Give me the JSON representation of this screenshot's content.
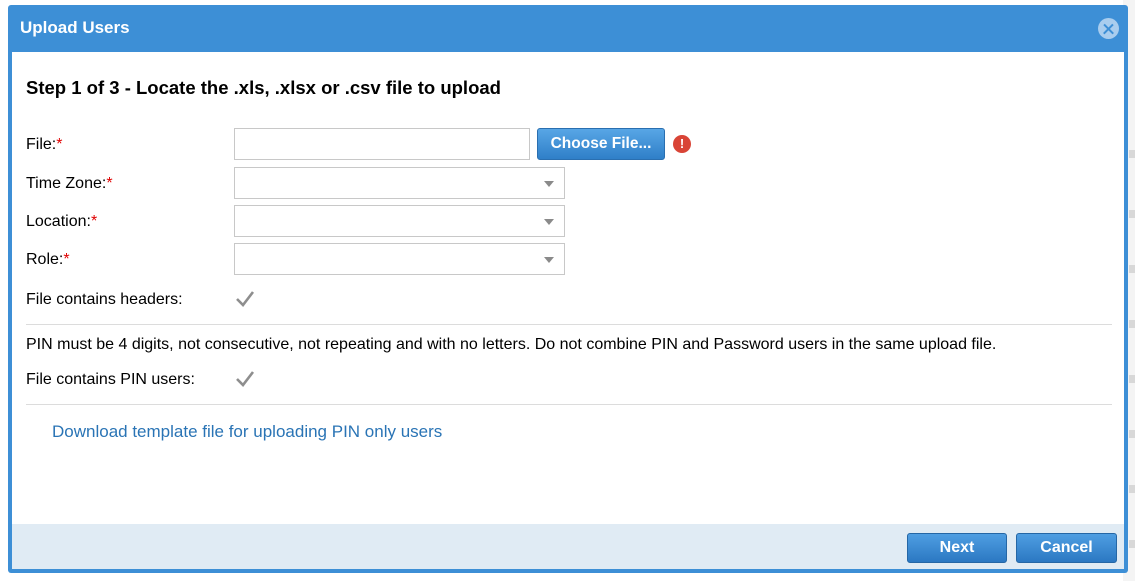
{
  "dialog": {
    "title": "Upload Users",
    "step_title": "Step 1 of 3 - Locate the .xls, .xlsx or .csv file to upload"
  },
  "form": {
    "file_label": "File:",
    "required_mark": "*",
    "file_value": "",
    "choose_file_label": "Choose File...",
    "error_icon": "!",
    "timezone_label": "Time Zone:",
    "timezone_value": "",
    "location_label": "Location:",
    "location_value": "",
    "role_label": "Role:",
    "role_value": "",
    "headers_label": "File contains headers:",
    "headers_checked": true,
    "pin_note": "PIN must be 4 digits, not consecutive, not repeating and with no letters. Do not combine PIN and Password users in the same upload file.",
    "pin_users_label": "File contains PIN users:",
    "pin_users_checked": true,
    "template_link": "Download template file for uploading PIN only users"
  },
  "footer": {
    "next_label": "Next",
    "cancel_label": "Cancel"
  },
  "colors": {
    "header": "#3d8fd6",
    "footer_bg": "#e0ebf4",
    "link": "#2a74b5",
    "required": "#e00000",
    "error": "#d94436"
  }
}
